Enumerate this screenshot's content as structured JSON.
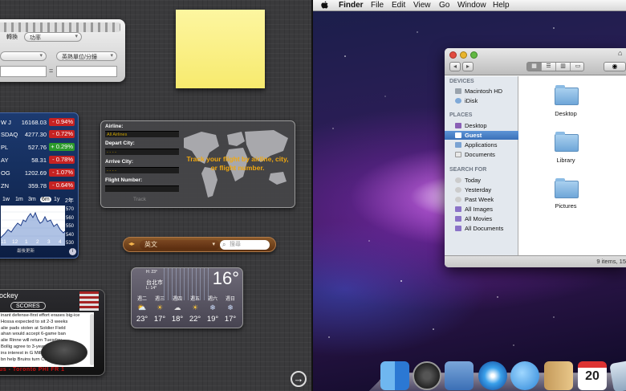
{
  "converter": {
    "type_label": "轉換",
    "type_value": "功率",
    "unit_right": "英熱單位/分鐘",
    "equals": "="
  },
  "stocks": {
    "rows": [
      {
        "symbol": "W J",
        "price": "16168.03",
        "change": "- 0.94%",
        "dir": "down"
      },
      {
        "symbol": "SDAQ",
        "price": "4277.30",
        "change": "- 0.72%",
        "dir": "down"
      },
      {
        "symbol": "PL",
        "price": "527.76",
        "change": "+ 0.29%",
        "dir": "up"
      },
      {
        "symbol": "AY",
        "price": "58.31",
        "change": "- 0.78%",
        "dir": "down"
      },
      {
        "symbol": "OG",
        "price": "1202.69",
        "change": "- 1.07%",
        "dir": "down"
      },
      {
        "symbol": "ZN",
        "price": "359.78",
        "change": "- 0.64%",
        "dir": "down"
      }
    ],
    "ranges": [
      "1w",
      "1m",
      "3m",
      "6m",
      "1y",
      "2年"
    ],
    "active_range": "6m",
    "y_ticks": [
      "570",
      "560",
      "550",
      "540",
      "530",
      "520"
    ],
    "x_ticks": [
      "11",
      "12",
      "1",
      "2",
      "3",
      "4"
    ],
    "footer": "最後更新"
  },
  "flight": {
    "airline_label": "Airline:",
    "airline_value": "All Airlines",
    "depart_label": "Depart City:",
    "arrive_label": "Arrive City:",
    "flight_label": "Flight Number:",
    "placeholder_dashes": "- - - -",
    "message": "Track your flight by airline, city, or flight number.",
    "track_button": "Track"
  },
  "translate": {
    "arrows": "◂▸",
    "language": "英文",
    "search_placeholder": "搜尋"
  },
  "weather": {
    "hi": "H: 23°",
    "city": "台北市",
    "lo": "L: 14°",
    "temp": "16°",
    "days": [
      {
        "day": "週二",
        "icon": "sun-cloud",
        "glyph": "⛅",
        "temp": "23°"
      },
      {
        "day": "週三",
        "icon": "sun",
        "glyph": "☀",
        "temp": "17°"
      },
      {
        "day": "週四",
        "icon": "cloudy",
        "glyph": "☁",
        "temp": "18°"
      },
      {
        "day": "週五",
        "icon": "sun",
        "glyph": "☀",
        "temp": "22°"
      },
      {
        "day": "週六",
        "icon": "snow",
        "glyph": "❄",
        "temp": "19°"
      },
      {
        "day": "週日",
        "icon": "snow",
        "glyph": "❄",
        "temp": "17°"
      }
    ]
  },
  "espn": {
    "header": "ockey",
    "scores_button": "SCORES",
    "news": [
      "inant defense-first effort erases big-ice",
      "Hossa expected to sit 2-3 weeks",
      "alie pads stolen at Soldier Field",
      "ahan would accept 6-game ban",
      "alie Rinne will return Tuesday",
      "Bollig agree to 3-year extension",
      "ins interest in G Miller's debut",
      "bn help Bruins turn Cup boast"
    ],
    "ticker": "us - Toronto  PHI  FR 1"
  },
  "dashboard": {
    "close_glyph": "→"
  },
  "menubar": {
    "apple": "",
    "items": [
      "Finder",
      "File",
      "Edit",
      "View",
      "Go",
      "Window",
      "Help"
    ]
  },
  "finder": {
    "devices_header": "DEVICES",
    "devices": [
      "Macintosh HD",
      "iDisk"
    ],
    "places_header": "PLACES",
    "places": [
      "Desktop",
      "Guest",
      "Applications",
      "Documents"
    ],
    "selected_place": "Guest",
    "search_header": "SEARCH FOR",
    "searches": [
      "Today",
      "Yesterday",
      "Past Week",
      "All Images",
      "All Movies",
      "All Documents"
    ],
    "folders": [
      "Desktop",
      "Library",
      "Pictures"
    ],
    "status": "9 items, 15"
  },
  "dock": {
    "apps": [
      "finder",
      "dashboard",
      "mail",
      "safari",
      "ichat",
      "address-book",
      "ical",
      "iphoto"
    ],
    "calendar_day": "20"
  }
}
